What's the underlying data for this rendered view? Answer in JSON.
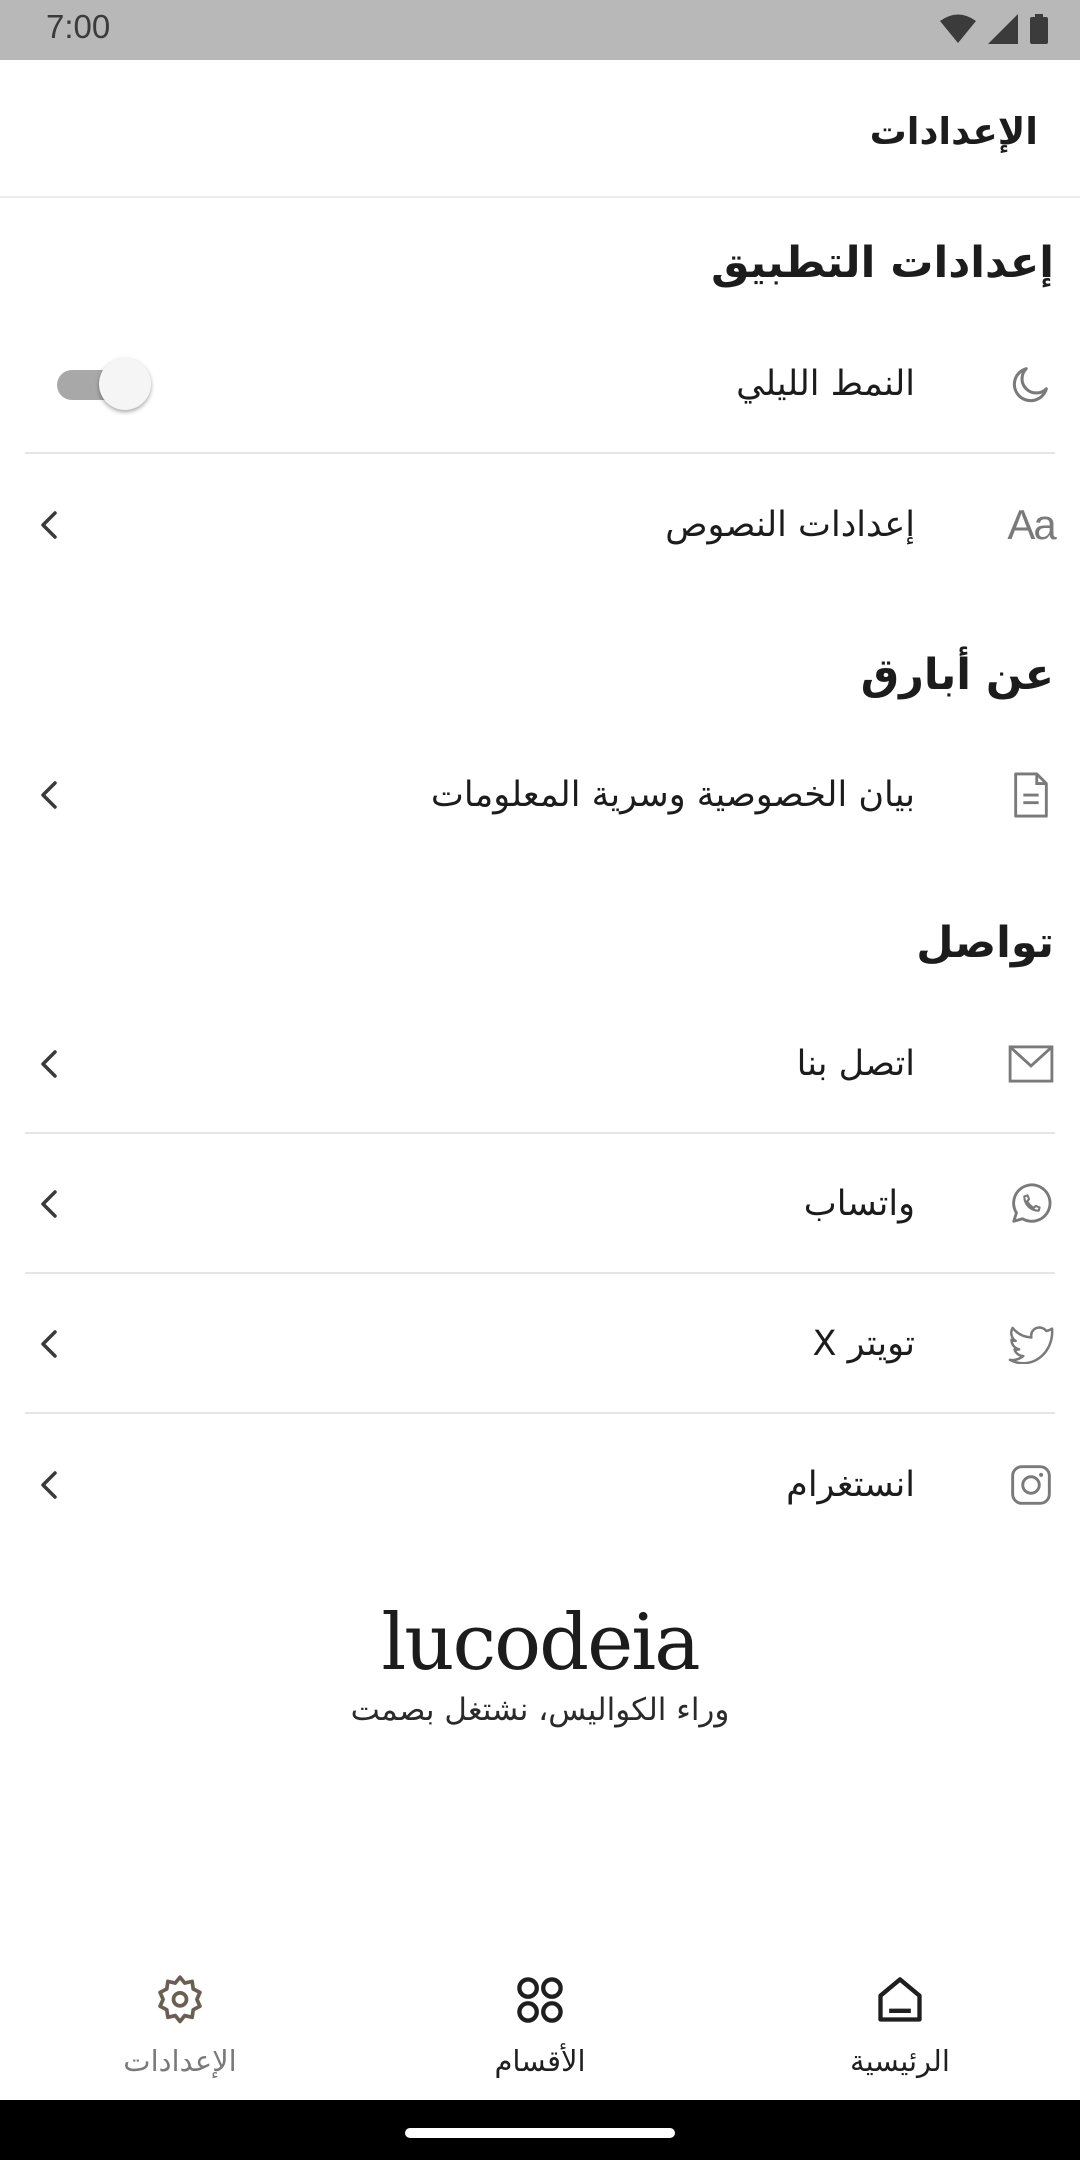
{
  "status_bar": {
    "time": "7:00"
  },
  "app_bar": {
    "title": "الإعدادات"
  },
  "sections": {
    "app_settings": {
      "title": "إعدادات التطبيق",
      "dark_mode_label": "النمط الليلي",
      "dark_mode_enabled": false,
      "text_settings_label": "إعدادات النصوص",
      "text_icon_glyph": "Aa"
    },
    "about": {
      "title": "عن أبارق",
      "privacy_label": "بيان الخصوصية وسرية المعلومات"
    },
    "contact": {
      "title": "تواصل",
      "contact_us_label": "اتصل بنا",
      "whatsapp_label": "واتساب",
      "twitter_label": "تويتر X",
      "instagram_label": "انستغرام"
    }
  },
  "brand": {
    "logo": "lucodeia",
    "tagline": "وراء الكواليس، نشتغل بصمت"
  },
  "bottom_nav": {
    "home_label": "الرئيسية",
    "categories_label": "الأقسام",
    "settings_label": "الإعدادات"
  },
  "colors": {
    "icon_gray": "#7a7a7a",
    "divider": "#e6e6e6",
    "status_bar": "#b8b8b8"
  }
}
